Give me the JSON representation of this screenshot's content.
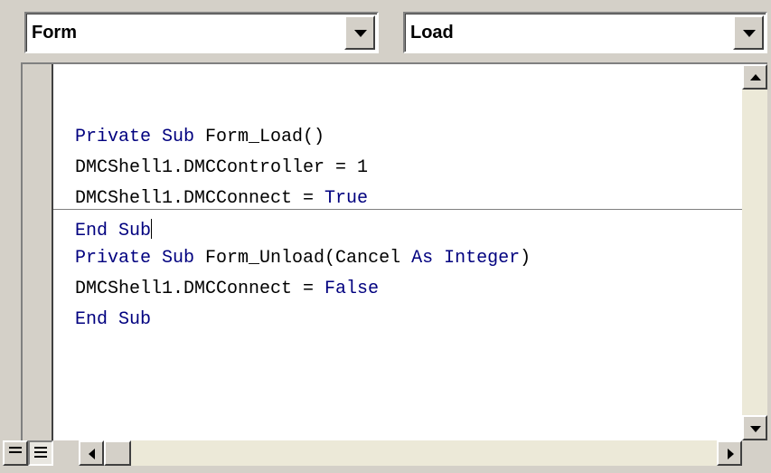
{
  "object_dropdown": {
    "value": "Form",
    "icon": "chevron-down-icon"
  },
  "procedure_dropdown": {
    "value": "Load",
    "icon": "chevron-down-icon"
  },
  "code": {
    "line1": {
      "kw1": "Private Sub",
      "rest": " Form_Load()"
    },
    "line2": {
      "text": "DMCShell1.DMCController = 1"
    },
    "line3": {
      "text": "DMCShell1.DMCConnect = ",
      "kw": "True"
    },
    "line4": {
      "kw": "End Sub"
    },
    "line5": {
      "kw1": "Private Sub",
      "mid": " Form_Unload(Cancel ",
      "kw2": "As Integer",
      "end": ")"
    },
    "line6": {
      "text": "DMCShell1.DMCConnect = ",
      "kw": "False"
    },
    "line7": {
      "kw": "End Sub"
    }
  },
  "colors": {
    "keyword": "#00007f",
    "text": "#000000",
    "chrome": "#d4d0c8"
  },
  "view_buttons": {
    "procedure_view": "procedure-view-icon",
    "full_module_view": "full-module-view-icon"
  }
}
